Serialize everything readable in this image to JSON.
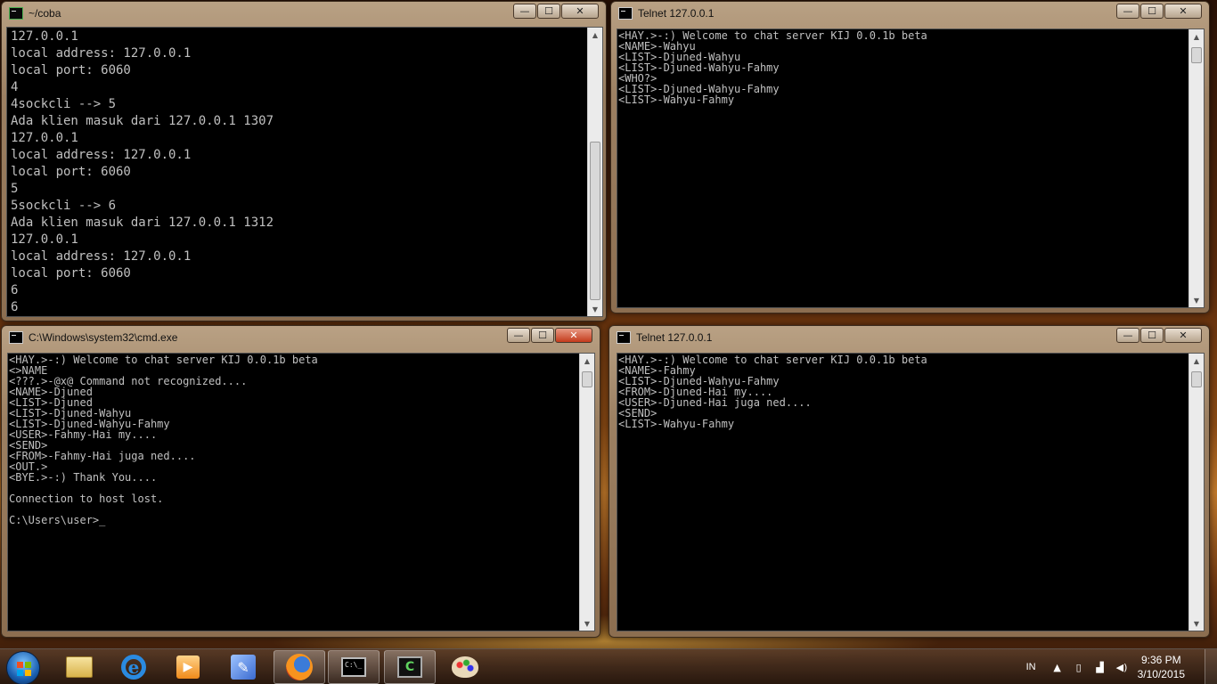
{
  "windows": {
    "cygwin": {
      "title": "~/coba",
      "lines": [
        "127.0.0.1",
        "local address: 127.0.0.1",
        "local port: 6060",
        "4",
        "4sockcli --> 5",
        "Ada klien masuk dari 127.0.0.1 1307",
        "127.0.0.1",
        "local address: 127.0.0.1",
        "local port: 6060",
        "5",
        "5sockcli --> 6",
        "Ada klien masuk dari 127.0.0.1 1312",
        "127.0.0.1",
        "local address: 127.0.0.1",
        "local port: 6060",
        "6",
        "6"
      ]
    },
    "telnet_top": {
      "title": "Telnet 127.0.0.1",
      "lines": [
        "<HAY.>-:) Welcome to chat server KIJ 0.0.1b beta",
        "<NAME>-Wahyu",
        "<LIST>-Djuned-Wahyu",
        "<LIST>-Djuned-Wahyu-Fahmy",
        "<WHO?>",
        "<LIST>-Djuned-Wahyu-Fahmy",
        "<LIST>-Wahyu-Fahmy"
      ]
    },
    "cmd": {
      "title": "C:\\Windows\\system32\\cmd.exe",
      "lines": [
        "<HAY.>-:) Welcome to chat server KIJ 0.0.1b beta",
        "<>NAME",
        "<???.>-@x@ Command not recognized....",
        "<NAME>-Djuned",
        "<LIST>-Djuned",
        "<LIST>-Djuned-Wahyu",
        "<LIST>-Djuned-Wahyu-Fahmy",
        "<USER>-Fahmy-Hai my....",
        "<SEND>",
        "<FROM>-Fahmy-Hai juga ned....",
        "<OUT.>",
        "<BYE.>-:) Thank You....",
        "",
        "Connection to host lost.",
        "",
        "C:\\Users\\user>_"
      ]
    },
    "telnet_bottom": {
      "title": "Telnet 127.0.0.1",
      "lines": [
        "<HAY.>-:) Welcome to chat server KIJ 0.0.1b beta",
        "<NAME>-Fahmy",
        "<LIST>-Djuned-Wahyu-Fahmy",
        "<FROM>-Djuned-Hai my....",
        "<USER>-Djuned-Hai juga ned....",
        "<SEND>",
        "<LIST>-Wahyu-Fahmy"
      ]
    },
    "controls": {
      "minimize": "—",
      "maximize": "☐",
      "close": "✕"
    }
  },
  "taskbar": {
    "pinned": [
      "windows-explorer-icon",
      "internet-explorer-icon",
      "media-player-icon",
      "tools-icon",
      "firefox-icon",
      "cmd-icon",
      "cygwin-icon",
      "paint-icon"
    ],
    "tray": {
      "language": "IN",
      "time": "9:36 PM",
      "date": "3/10/2015"
    }
  }
}
